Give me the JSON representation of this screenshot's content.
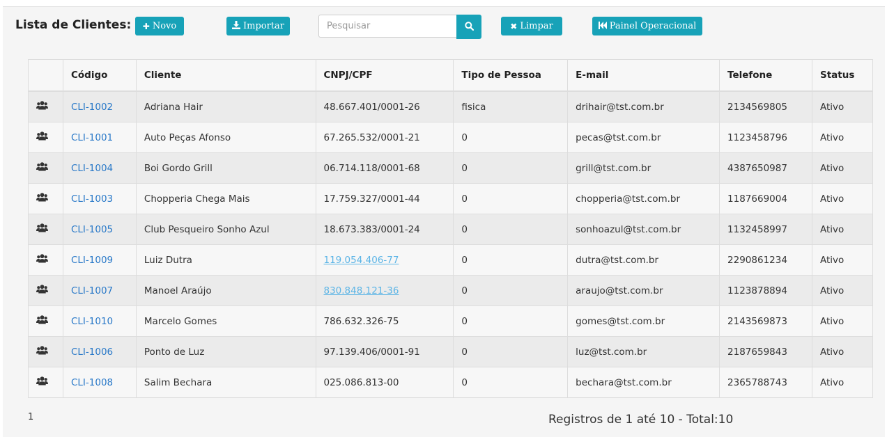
{
  "page": {
    "title": "Lista de Clientes:",
    "accent_color": "#17a2b8",
    "link_color": "#2878c8"
  },
  "toolbar": {
    "novo": {
      "label": "Novo",
      "icon": "plus-icon"
    },
    "importar": {
      "label": "Importar",
      "icon": "download-icon"
    },
    "search": {
      "placeholder": "Pesquisar",
      "value": "",
      "icon": "search-icon"
    },
    "limpar": {
      "label": "Limpar",
      "icon": "close-icon"
    },
    "painel": {
      "label": "Painel Operacional",
      "icon": "fast-backward-icon"
    }
  },
  "table": {
    "columns": [
      "",
      "Código",
      "Cliente",
      "CNPJ/CPF",
      "Tipo de Pessoa",
      "E-mail",
      "Telefone",
      "Status"
    ],
    "row_icon": "users-icon",
    "rows": [
      {
        "codigo": "CLI-1002",
        "cliente": "Adriana Hair",
        "doc": "48.667.401/0001-26",
        "tipo": "fisica",
        "email": "drihair@tst.com.br",
        "telefone": "2134569805",
        "status": "Ativo"
      },
      {
        "codigo": "CLI-1001",
        "cliente": "Auto Peças Afonso",
        "doc": "67.265.532/0001-21",
        "tipo": "0",
        "email": "pecas@tst.com.br",
        "telefone": "1123458796",
        "status": "Ativo"
      },
      {
        "codigo": "CLI-1004",
        "cliente": "Boi Gordo Grill",
        "doc": "06.714.118/0001-68",
        "tipo": "0",
        "email": "grill@tst.com.br",
        "telefone": "4387650987",
        "status": "Ativo"
      },
      {
        "codigo": "CLI-1003",
        "cliente": "Chopperia Chega Mais",
        "doc": "17.759.327/0001-44",
        "tipo": "0",
        "email": "chopperia@tst.com.br",
        "telefone": "1187669004",
        "status": "Ativo"
      },
      {
        "codigo": "CLI-1005",
        "cliente": "Club Pesqueiro Sonho Azul",
        "doc": "18.673.383/0001-24",
        "tipo": "0",
        "email": "sonhoazul@tst.com.br",
        "telefone": "1132458997",
        "status": "Ativo"
      },
      {
        "codigo": "CLI-1009",
        "cliente": "Luiz Dutra",
        "doc": "119.054.406-77",
        "tipo": "0",
        "email": "dutra@tst.com.br",
        "telefone": "2290861234",
        "status": "Ativo"
      },
      {
        "codigo": "CLI-1007",
        "cliente": "Manoel Araújo",
        "doc": "830.848.121-36",
        "tipo": "0",
        "email": "araujo@tst.com.br",
        "telefone": "1123878894",
        "status": "Ativo"
      },
      {
        "codigo": "CLI-1010",
        "cliente": "Marcelo Gomes",
        "doc": "786.632.326-75",
        "tipo": "0",
        "email": "gomes@tst.com.br",
        "telefone": "2143569873",
        "status": "Ativo"
      },
      {
        "codigo": "CLI-1006",
        "cliente": "Ponto de Luz",
        "doc": "97.139.406/0001-91",
        "tipo": "0",
        "email": "luz@tst.com.br",
        "telefone": "2187659843",
        "status": "Ativo"
      },
      {
        "codigo": "CLI-1008",
        "cliente": "Salim Bechara",
        "doc": "025.086.813-00",
        "tipo": "0",
        "email": "bechara@tst.com.br",
        "telefone": "2365788743",
        "status": "Ativo"
      }
    ]
  },
  "footer": {
    "page": "1",
    "summary": "Registros de 1 até 10 - Total:10"
  }
}
